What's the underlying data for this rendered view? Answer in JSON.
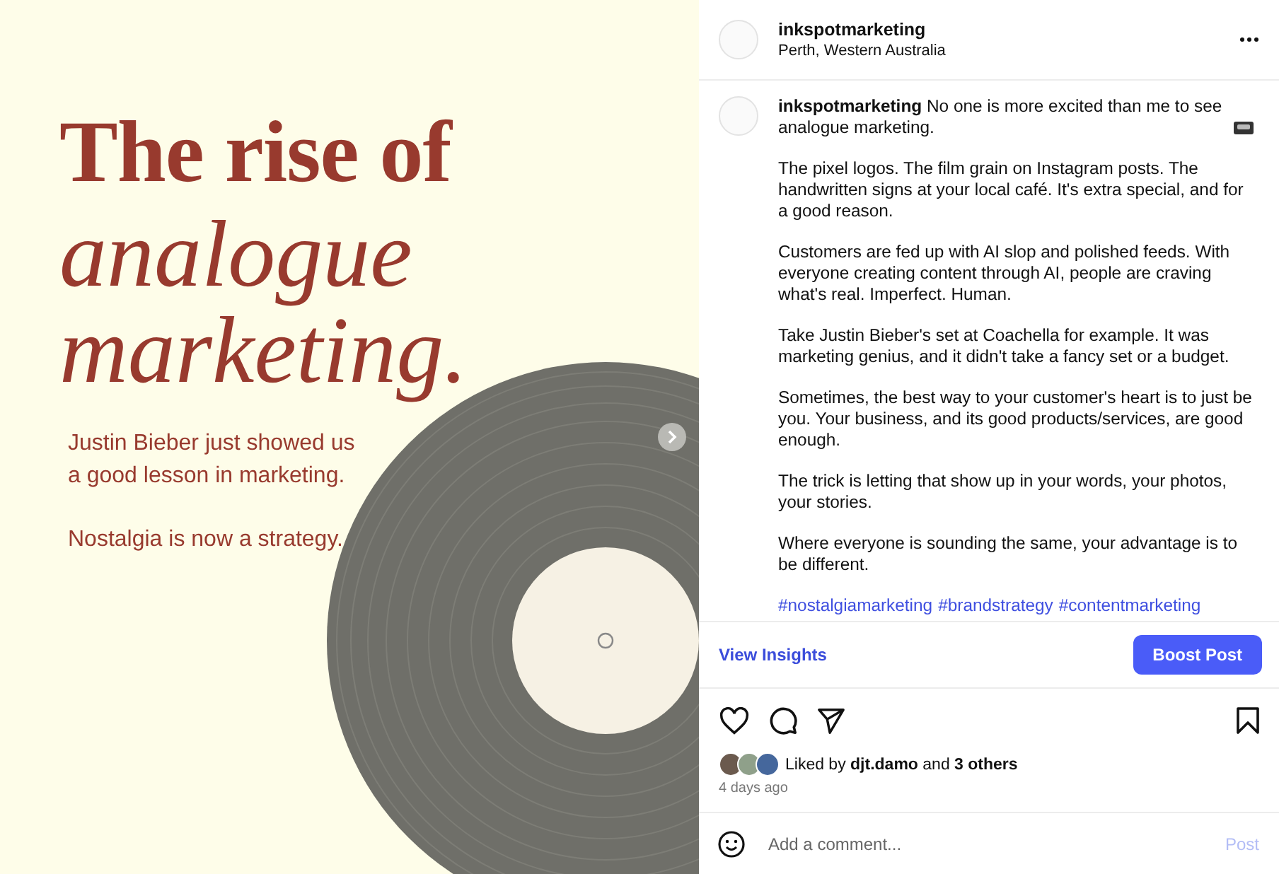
{
  "slide": {
    "title": "The rise of",
    "italic_lines": [
      "analogue",
      "marketing."
    ],
    "subtitle_lines": [
      "Justin Bieber just showed us",
      "a good lesson in marketing."
    ],
    "tagline": "Nostalgia is now a strategy."
  },
  "header": {
    "username": "inkspotmarketing",
    "location": "Perth, Western Australia"
  },
  "caption": {
    "paragraphs": [
      "**inkspotmarketing** No one is more excited than me to see analogue marketing.",
      "The pixel logos. The film grain on Instagram posts. The handwritten signs at your local café. It's extra special, and for a good reason.",
      "Customers are fed up with AI slop and polished feeds. With everyone creating content through AI, people are craving what's real. Imperfect. Human.",
      "Take Justin Bieber's set at Coachella for example. It was marketing genius, and it didn't take a fancy set or a budget.",
      "Sometimes, the best way to your customer's heart is to just be you. Your business, and its good products/services, are good enough.",
      "The trick is letting that show up in your words, your photos, your stories.",
      "Where everyone is sounding the same, your advantage is to be different."
    ],
    "hashtags": [
      "#nostalgiamarketing",
      "#brandstrategy",
      "#contentmarketing"
    ]
  },
  "insights": {
    "link": "View Insights",
    "button": "Boost Post"
  },
  "likes": {
    "text": "Liked by **djt.damo** and **3 others**",
    "time": "4 days ago"
  },
  "comment_box": {
    "placeholder": "Add a comment...",
    "post": "Post",
    "post_enabled": false
  }
}
